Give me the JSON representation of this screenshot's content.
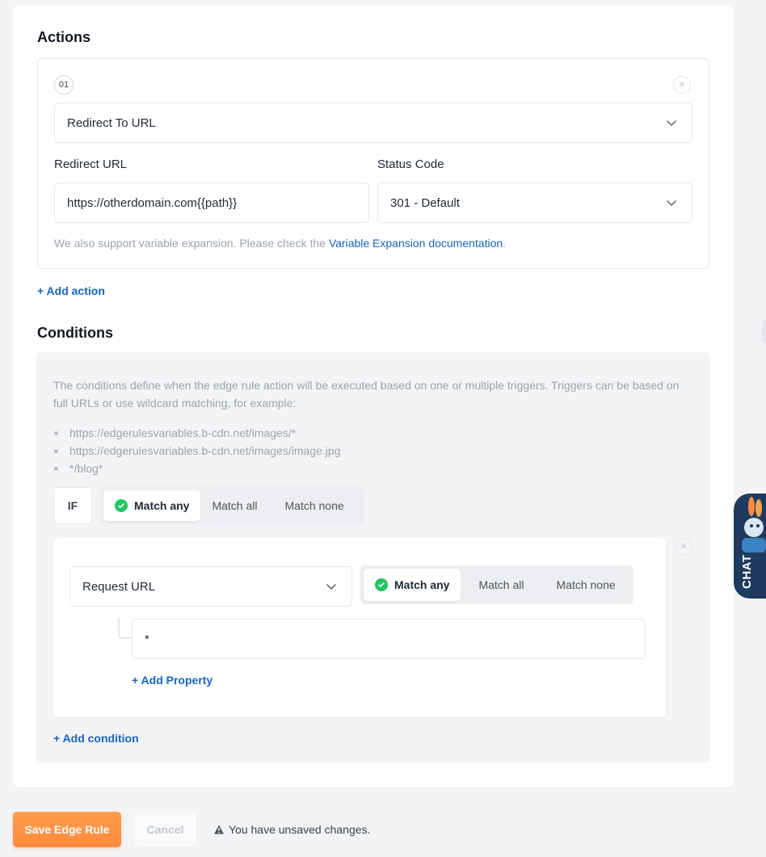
{
  "actions": {
    "heading": "Actions",
    "item": {
      "number": "01",
      "close_glyph": "×",
      "action_type": "Redirect To URL",
      "redirect_url_label": "Redirect URL",
      "redirect_url_value": "https://otherdomain.com{{path}}",
      "status_code_label": "Status Code",
      "status_code_value": "301 - Default",
      "help_text": "We also support variable expansion. Please check the",
      "help_link": "Variable Expansion documentation",
      "help_end": "."
    },
    "add_action": "+ Add action"
  },
  "conditions": {
    "heading": "Conditions",
    "description": "The conditions define when the edge rule action will be executed based on one or multiple triggers. Triggers can be based on full URLs or use wildcard matching, for example:",
    "examples": [
      "https://edgerulesvariables.b-cdn.net/images/*",
      "https://edgerulesvariables.b-cdn.net/images/image.jpg",
      "*/blog*"
    ],
    "if_label": "IF",
    "match_options": [
      "Match any",
      "Match all",
      "Match none"
    ],
    "match_selected": "Match any",
    "condition": {
      "close_glyph": "×",
      "type": "Request URL",
      "match_options": [
        "Match any",
        "Match all",
        "Match none"
      ],
      "match_selected": "Match any",
      "property_value": "*",
      "add_property": "+ Add Property"
    },
    "add_condition": "+ Add condition"
  },
  "footer": {
    "save": "Save Edge Rule",
    "cancel": "Cancel",
    "warning": "You have unsaved changes."
  },
  "chat": {
    "label": "CHAT"
  },
  "colors": {
    "accent": "#1565c0",
    "save": "#ff8a3d",
    "check": "#22c55e"
  }
}
